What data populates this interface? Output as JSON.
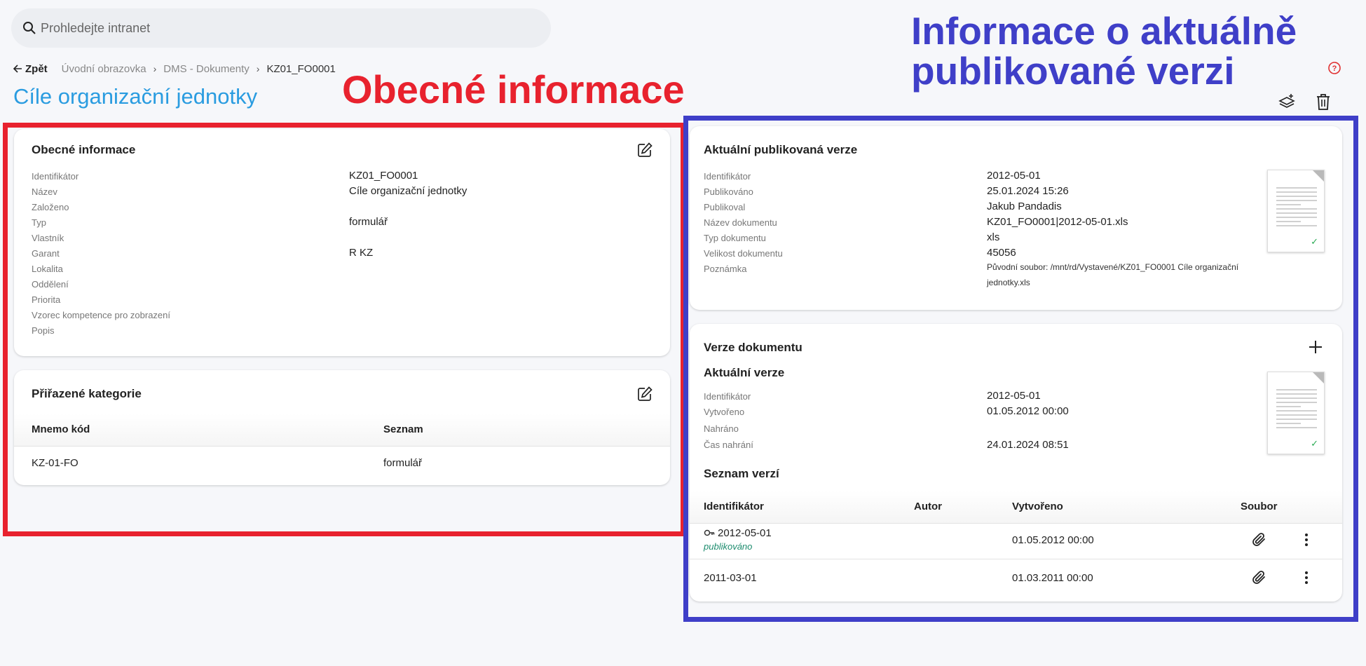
{
  "search": {
    "placeholder": "Prohledejte intranet"
  },
  "breadcrumb": {
    "back_label": "Zpět",
    "items": [
      "Úvodní obrazovka",
      "DMS - Dokumenty",
      "KZ01_FO0001"
    ]
  },
  "page": {
    "title": "Cíle organizační jednotky"
  },
  "annotations": {
    "general": "Obecné informace",
    "published_line1": "Informace o aktuálně",
    "published_line2": "publikované verzi"
  },
  "general_info": {
    "title": "Obecné informace",
    "fields": [
      {
        "label": "Identifikátor",
        "value": "KZ01_FO0001"
      },
      {
        "label": "Název",
        "value": "Cíle organizační jednotky"
      },
      {
        "label": "Založeno",
        "value": ""
      },
      {
        "label": "Typ",
        "value": "formulář"
      },
      {
        "label": "Vlastník",
        "value": ""
      },
      {
        "label": "Garant",
        "value": "R KZ"
      },
      {
        "label": "Lokalita",
        "value": ""
      },
      {
        "label": "Oddělení",
        "value": ""
      },
      {
        "label": "Priorita",
        "value": ""
      },
      {
        "label": "Vzorec kompetence pro zobrazení",
        "value": ""
      },
      {
        "label": "Popis",
        "value": ""
      }
    ]
  },
  "categories": {
    "title": "Přiřazené kategorie",
    "columns": [
      "Mnemo kód",
      "Seznam"
    ],
    "rows": [
      {
        "code": "KZ-01-FO",
        "list": "formulář"
      }
    ]
  },
  "published": {
    "title": "Aktuální publikovaná verze",
    "fields": [
      {
        "label": "Identifikátor",
        "value": "2012-05-01"
      },
      {
        "label": "Publikováno",
        "value": "25.01.2024 15:26"
      },
      {
        "label": "Publikoval",
        "value": "Jakub Pandadis"
      },
      {
        "label": "Název dokumentu",
        "value": "KZ01_FO0001|2012-05-01.xls"
      },
      {
        "label": "Typ dokumentu",
        "value": "xls"
      },
      {
        "label": "Velikost dokumentu",
        "value": "45056"
      }
    ],
    "note_label": "Poznámka",
    "note_value": "Původní soubor: /mnt/rd/Vystavené/KZ01_FO0001 Cíle organizační jednotky.xls"
  },
  "versions": {
    "title": "Verze dokumentu",
    "current_title": "Aktuální verze",
    "current_fields": [
      {
        "label": "Identifikátor",
        "value": "2012-05-01"
      },
      {
        "label": "Vytvořeno",
        "value": "01.05.2012 00:00"
      },
      {
        "label": "Nahráno",
        "value": ""
      },
      {
        "label": "Čas nahrání",
        "value": "24.01.2024 08:51"
      }
    ],
    "list_title": "Seznam verzí",
    "columns": [
      "Identifikátor",
      "Autor",
      "Vytvořeno",
      "Soubor"
    ],
    "rows": [
      {
        "id": "2012-05-01",
        "status": "publikováno",
        "author": "",
        "created": "01.05.2012 00:00"
      },
      {
        "id": "2011-03-01",
        "status": "",
        "author": "",
        "created": "01.03.2011 00:00"
      }
    ]
  },
  "colors": {
    "accent": "#2a9ce0",
    "annotation_red": "#e8222e",
    "annotation_blue": "#3f3fc8",
    "published_green": "#1d8c6e"
  }
}
